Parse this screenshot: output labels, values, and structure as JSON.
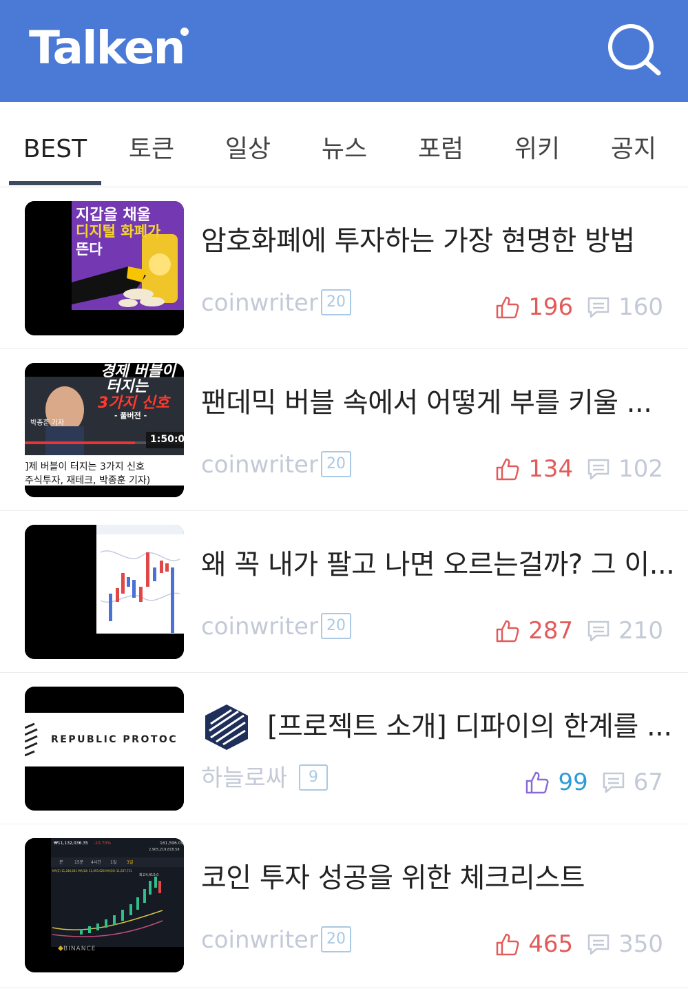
{
  "app": {
    "logo": "Talken"
  },
  "icons": {
    "search": "search-icon",
    "like": "thumbs-up-icon",
    "comment": "comment-icon"
  },
  "colors": {
    "header": "#4a7ad6",
    "like_red": "#e35a5a",
    "like_purple": "#8a6ad8",
    "like_count_blue": "#2d9cd6"
  },
  "tabs": [
    {
      "label": "BEST",
      "active": true
    },
    {
      "label": "토큰"
    },
    {
      "label": "일상"
    },
    {
      "label": "뉴스"
    },
    {
      "label": "포럼"
    },
    {
      "label": "위키"
    },
    {
      "label": "공지"
    }
  ],
  "posts": [
    {
      "title": "암호화폐에 투자하는 가장 현명한 방법",
      "author": "coinwriter",
      "level": "20",
      "likes": "196",
      "comments": "160",
      "thumb": {
        "title_line1": "지갑을 채울",
        "title_line2": "디지털 화폐가",
        "title_line3": "뜬다"
      }
    },
    {
      "title": "팬데믹 버블 속에서 어떻게 부를 키울 ...",
      "author": "coinwriter",
      "level": "20",
      "likes": "134",
      "comments": "102",
      "thumb": {
        "line1": "경제 버블이",
        "line2": "터지는",
        "line3": "3가지 신호",
        "tag": "- 풀버전 -",
        "name": "박종훈 기자",
        "duration": "1:50:0",
        "caption1": "]제 버블이 터지는 3가지 신호",
        "caption2": "주식투자, 재테크, 박종훈 기자)"
      }
    },
    {
      "title": "왜 꼭 내가 팔고 나면 오르는걸까? 그 이...",
      "author": "coinwriter",
      "level": "20",
      "likes": "287",
      "comments": "210"
    },
    {
      "title": "[프로젝트 소개] 디파이의 한계를 ...",
      "author": "하늘로싸",
      "level": "9",
      "likes": "99",
      "comments": "67",
      "thumb": {
        "brand": "REPUBLIC PROTOC"
      }
    },
    {
      "title": "코인 투자 성공을 위한 체크리스트",
      "author": "coinwriter",
      "level": "20",
      "likes": "465",
      "comments": "350",
      "thumb": {
        "brand": "BINANCE",
        "price": "₩11,132,036.35",
        "change": "-10.70%",
        "volume": "161,596.09",
        "volume2": "2,905,219,818.58",
        "legend": "MA(5) 11,246,641   MA(10) 11,093,626   MA(30) 11,637,711",
        "label_high": "최고4,410,0",
        "periods": [
          "분",
          "15분",
          "4시간",
          "1일",
          "3일"
        ]
      }
    }
  ]
}
